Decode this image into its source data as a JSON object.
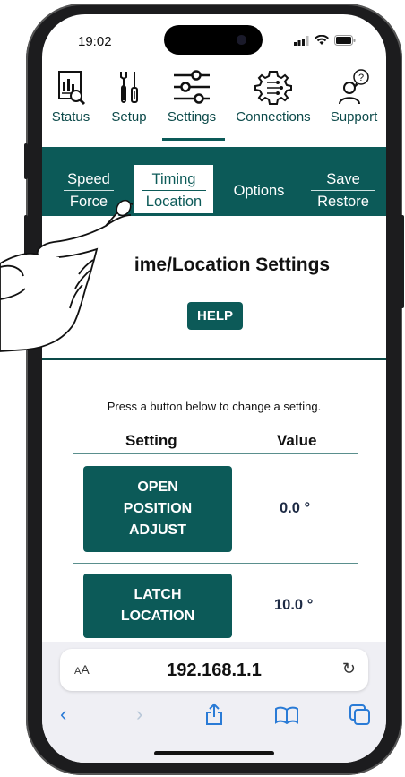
{
  "status_bar": {
    "time": "19:02"
  },
  "nav": {
    "items": [
      {
        "label": "Status",
        "icon": "chart-magnifier-icon"
      },
      {
        "label": "Setup",
        "icon": "tools-icon"
      },
      {
        "label": "Settings",
        "icon": "sliders-icon",
        "active": true
      },
      {
        "label": "Connections",
        "icon": "gear-circuit-icon"
      },
      {
        "label": "Support",
        "icon": "person-question-icon"
      }
    ]
  },
  "subtabs": [
    {
      "top": "Speed",
      "bottom": "Force"
    },
    {
      "top": "Timing",
      "bottom": "Location",
      "active": true
    },
    {
      "single": "Options"
    },
    {
      "top": "Save",
      "bottom": "Restore"
    }
  ],
  "page": {
    "heading": "ime/Location Settings",
    "help_label": "HELP",
    "instructions": "Press a button below to change a setting.",
    "col_setting": "Setting",
    "col_value": "Value",
    "rows": [
      {
        "lines": [
          "OPEN",
          "POSITION",
          "ADJUST"
        ],
        "value": "0.0 °"
      },
      {
        "lines": [
          "LATCH",
          "LOCATION"
        ],
        "value": "10.0 °"
      }
    ]
  },
  "safari": {
    "text_size": "AA",
    "url": "192.168.1.1",
    "reload_icon": "reload-icon"
  },
  "colors": {
    "teal": "#0c5a58",
    "link": "#2a7bd6"
  }
}
